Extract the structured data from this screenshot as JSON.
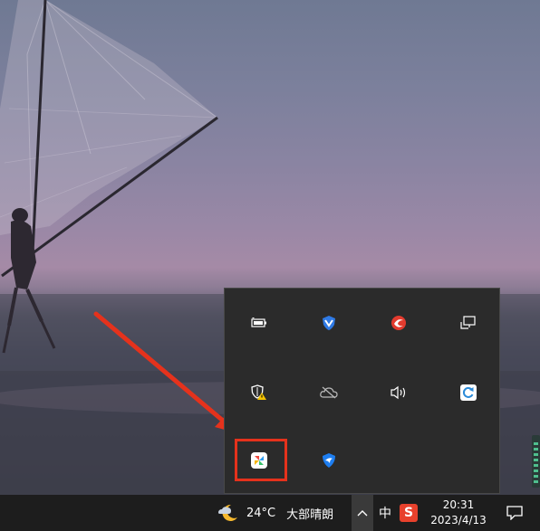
{
  "taskbar": {
    "weather": {
      "icon": "moon-cloud-icon",
      "temperature": "24°C",
      "condition": "大部晴朗"
    },
    "show_hidden_icons": "chevron-up-icon",
    "ime_mode": "中",
    "sogou_icon_label": "S",
    "clock": {
      "time": "20:31",
      "date": "2023/4/13"
    },
    "notification_icon": "notification-center-icon"
  },
  "tray_flyout": {
    "icons": [
      "battery-icon",
      "shield-v-icon",
      "red-swirl-app-icon",
      "network-monitor-icon",
      "defender-warning-icon",
      "onedrive-offline-icon",
      "volume-icon",
      "refresh-sync-app-icon",
      "colorful-app-icon",
      "blue-bird-app-icon"
    ]
  },
  "annotation": {
    "arrow_color": "#e5321c",
    "box_color": "#e5321c"
  }
}
